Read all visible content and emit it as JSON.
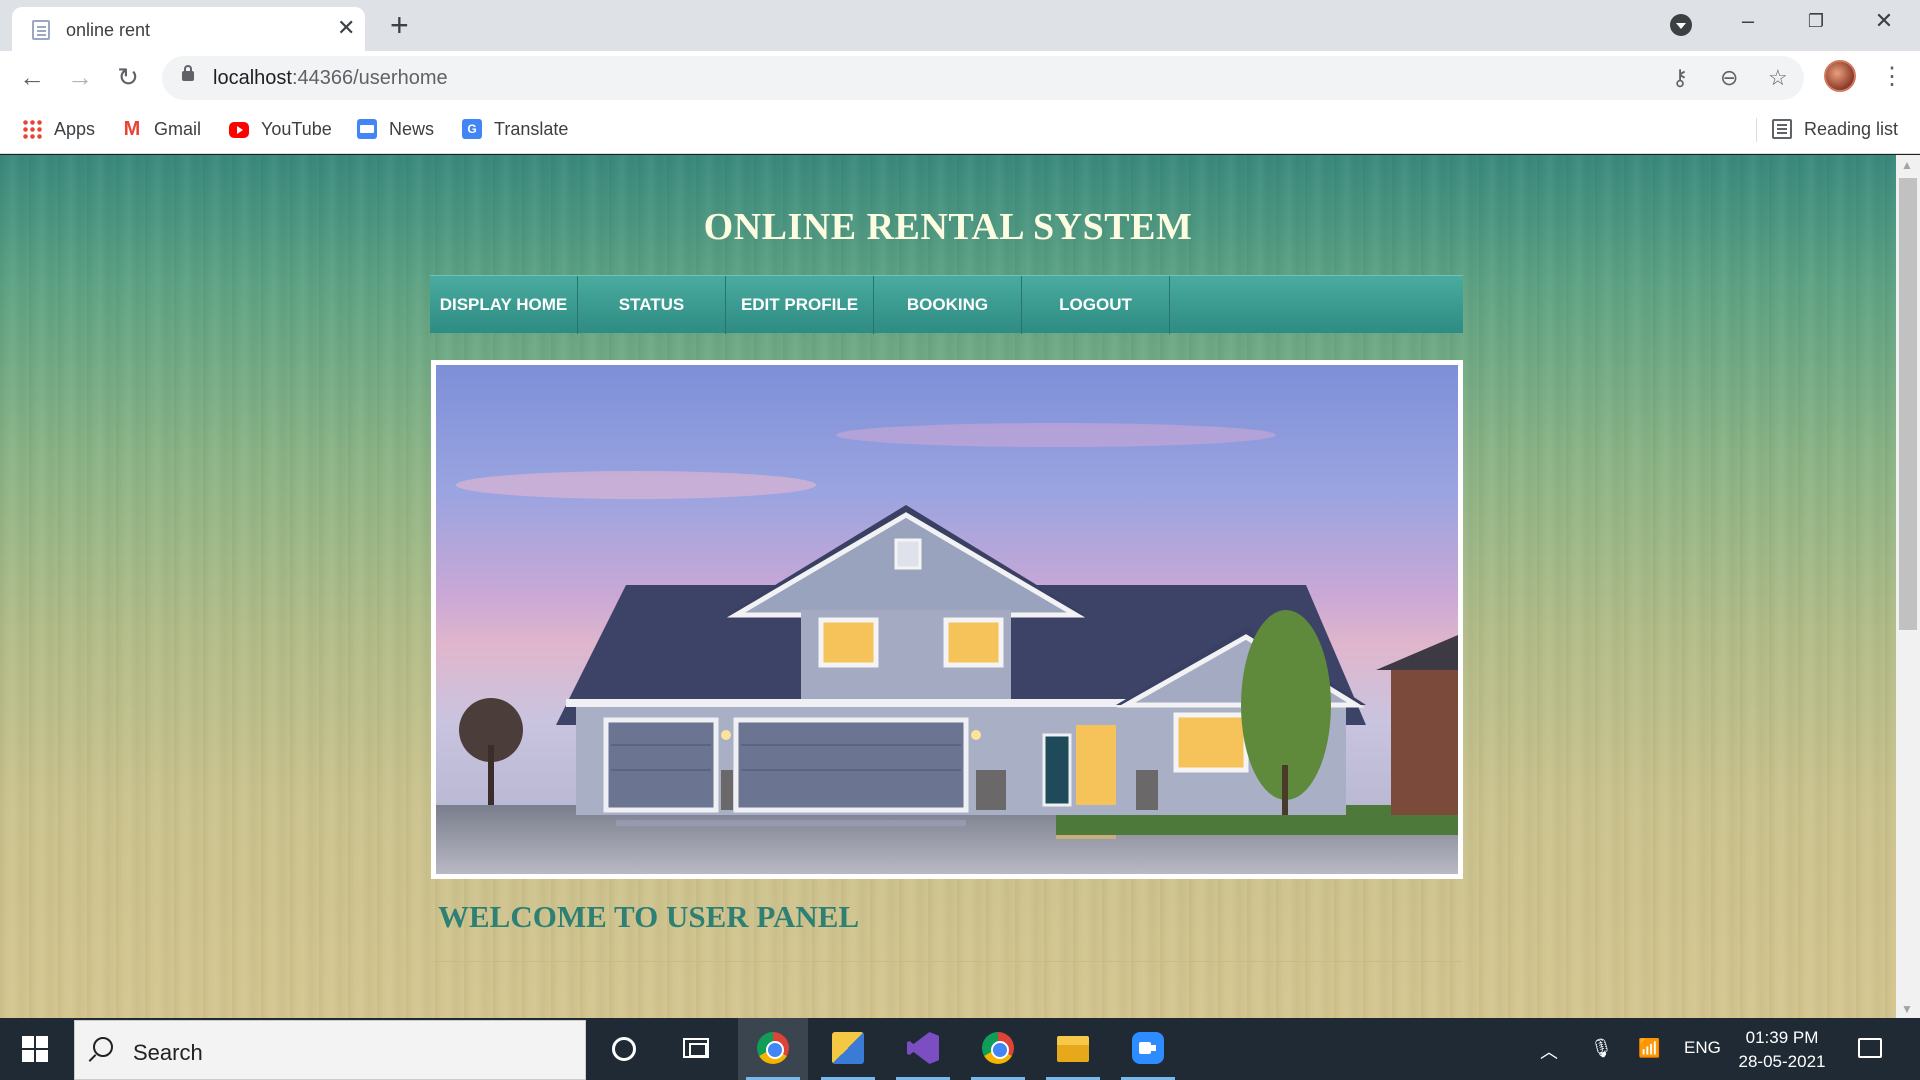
{
  "browser": {
    "tab_title": "online rent",
    "url_host": "localhost",
    "url_path": ":44366/userhome",
    "bookmarks": [
      "Apps",
      "Gmail",
      "YouTube",
      "News",
      "Translate"
    ],
    "reading_list": "Reading list"
  },
  "page": {
    "site_title": "ONLINE RENTAL SYSTEM",
    "nav": [
      "DISPLAY HOME",
      "STATUS",
      "EDIT PROFILE",
      "BOOKING",
      "LOGOUT"
    ],
    "welcome": "WELCOME TO USER PANEL",
    "colors": {
      "nav_bg": "#3a9a8f",
      "title": "#fdfbe0",
      "welcome": "#2e8074"
    }
  },
  "taskbar": {
    "search_placeholder": "Search",
    "language": "ENG",
    "time": "01:39 PM",
    "date": "28-05-2021"
  }
}
